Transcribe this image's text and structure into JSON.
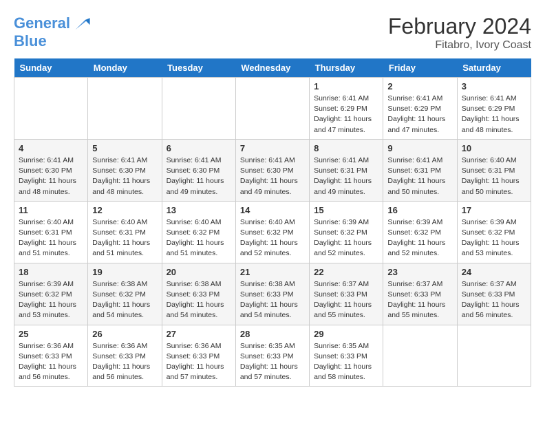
{
  "header": {
    "logo_line1": "General",
    "logo_line2": "Blue",
    "month": "February 2024",
    "location": "Fitabro, Ivory Coast"
  },
  "days_of_week": [
    "Sunday",
    "Monday",
    "Tuesday",
    "Wednesday",
    "Thursday",
    "Friday",
    "Saturday"
  ],
  "weeks": [
    [
      {
        "day": "",
        "info": ""
      },
      {
        "day": "",
        "info": ""
      },
      {
        "day": "",
        "info": ""
      },
      {
        "day": "",
        "info": ""
      },
      {
        "day": "1",
        "info": "Sunrise: 6:41 AM\nSunset: 6:29 PM\nDaylight: 11 hours\nand 47 minutes."
      },
      {
        "day": "2",
        "info": "Sunrise: 6:41 AM\nSunset: 6:29 PM\nDaylight: 11 hours\nand 47 minutes."
      },
      {
        "day": "3",
        "info": "Sunrise: 6:41 AM\nSunset: 6:29 PM\nDaylight: 11 hours\nand 48 minutes."
      }
    ],
    [
      {
        "day": "4",
        "info": "Sunrise: 6:41 AM\nSunset: 6:30 PM\nDaylight: 11 hours\nand 48 minutes."
      },
      {
        "day": "5",
        "info": "Sunrise: 6:41 AM\nSunset: 6:30 PM\nDaylight: 11 hours\nand 48 minutes."
      },
      {
        "day": "6",
        "info": "Sunrise: 6:41 AM\nSunset: 6:30 PM\nDaylight: 11 hours\nand 49 minutes."
      },
      {
        "day": "7",
        "info": "Sunrise: 6:41 AM\nSunset: 6:30 PM\nDaylight: 11 hours\nand 49 minutes."
      },
      {
        "day": "8",
        "info": "Sunrise: 6:41 AM\nSunset: 6:31 PM\nDaylight: 11 hours\nand 49 minutes."
      },
      {
        "day": "9",
        "info": "Sunrise: 6:41 AM\nSunset: 6:31 PM\nDaylight: 11 hours\nand 50 minutes."
      },
      {
        "day": "10",
        "info": "Sunrise: 6:40 AM\nSunset: 6:31 PM\nDaylight: 11 hours\nand 50 minutes."
      }
    ],
    [
      {
        "day": "11",
        "info": "Sunrise: 6:40 AM\nSunset: 6:31 PM\nDaylight: 11 hours\nand 51 minutes."
      },
      {
        "day": "12",
        "info": "Sunrise: 6:40 AM\nSunset: 6:31 PM\nDaylight: 11 hours\nand 51 minutes."
      },
      {
        "day": "13",
        "info": "Sunrise: 6:40 AM\nSunset: 6:32 PM\nDaylight: 11 hours\nand 51 minutes."
      },
      {
        "day": "14",
        "info": "Sunrise: 6:40 AM\nSunset: 6:32 PM\nDaylight: 11 hours\nand 52 minutes."
      },
      {
        "day": "15",
        "info": "Sunrise: 6:39 AM\nSunset: 6:32 PM\nDaylight: 11 hours\nand 52 minutes."
      },
      {
        "day": "16",
        "info": "Sunrise: 6:39 AM\nSunset: 6:32 PM\nDaylight: 11 hours\nand 52 minutes."
      },
      {
        "day": "17",
        "info": "Sunrise: 6:39 AM\nSunset: 6:32 PM\nDaylight: 11 hours\nand 53 minutes."
      }
    ],
    [
      {
        "day": "18",
        "info": "Sunrise: 6:39 AM\nSunset: 6:32 PM\nDaylight: 11 hours\nand 53 minutes."
      },
      {
        "day": "19",
        "info": "Sunrise: 6:38 AM\nSunset: 6:32 PM\nDaylight: 11 hours\nand 54 minutes."
      },
      {
        "day": "20",
        "info": "Sunrise: 6:38 AM\nSunset: 6:33 PM\nDaylight: 11 hours\nand 54 minutes."
      },
      {
        "day": "21",
        "info": "Sunrise: 6:38 AM\nSunset: 6:33 PM\nDaylight: 11 hours\nand 54 minutes."
      },
      {
        "day": "22",
        "info": "Sunrise: 6:37 AM\nSunset: 6:33 PM\nDaylight: 11 hours\nand 55 minutes."
      },
      {
        "day": "23",
        "info": "Sunrise: 6:37 AM\nSunset: 6:33 PM\nDaylight: 11 hours\nand 55 minutes."
      },
      {
        "day": "24",
        "info": "Sunrise: 6:37 AM\nSunset: 6:33 PM\nDaylight: 11 hours\nand 56 minutes."
      }
    ],
    [
      {
        "day": "25",
        "info": "Sunrise: 6:36 AM\nSunset: 6:33 PM\nDaylight: 11 hours\nand 56 minutes."
      },
      {
        "day": "26",
        "info": "Sunrise: 6:36 AM\nSunset: 6:33 PM\nDaylight: 11 hours\nand 56 minutes."
      },
      {
        "day": "27",
        "info": "Sunrise: 6:36 AM\nSunset: 6:33 PM\nDaylight: 11 hours\nand 57 minutes."
      },
      {
        "day": "28",
        "info": "Sunrise: 6:35 AM\nSunset: 6:33 PM\nDaylight: 11 hours\nand 57 minutes."
      },
      {
        "day": "29",
        "info": "Sunrise: 6:35 AM\nSunset: 6:33 PM\nDaylight: 11 hours\nand 58 minutes."
      },
      {
        "day": "",
        "info": ""
      },
      {
        "day": "",
        "info": ""
      }
    ]
  ]
}
